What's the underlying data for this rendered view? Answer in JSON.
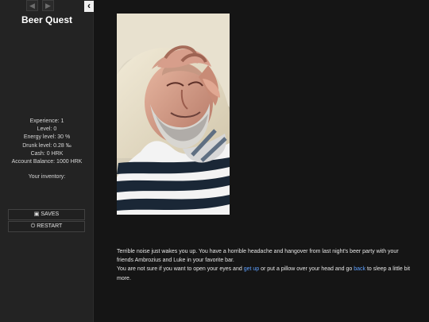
{
  "sidebar": {
    "title": "Beer Quest",
    "nav": {
      "back_icon": "arrow-left-icon",
      "forward_icon": "arrow-right-icon",
      "collapse_icon": "chevron-left-icon"
    },
    "stats": {
      "experience": "Experience: 1",
      "level": "Level: 0",
      "energy": "Energy level: 30 %",
      "drunk": "Drunk level: 0.28 ‰",
      "cash": "Cash: 0 HRK",
      "balance": "Account Balance: 1000 HRK"
    },
    "inventory_label": "Your inventory:",
    "buttons": {
      "saves": "SAVES",
      "restart": "RESTART"
    }
  },
  "main": {
    "story": {
      "line1": "Terrible noise just wakes you up. You have a horrible headache and hangover from last night's beer party with your friends Ambrozius and Luke in your favorite bar.",
      "line2_prefix": "You are not sure if you want to open your eyes and ",
      "get_up_link": "get up",
      "line2_middle": " or put a pillow over your head and go ",
      "back_link": "back",
      "line2_suffix": " to sleep a little bit more."
    }
  },
  "colors": {
    "sidebar_bg": "#232323",
    "main_bg": "#151515",
    "link": "#5ea0ff"
  }
}
